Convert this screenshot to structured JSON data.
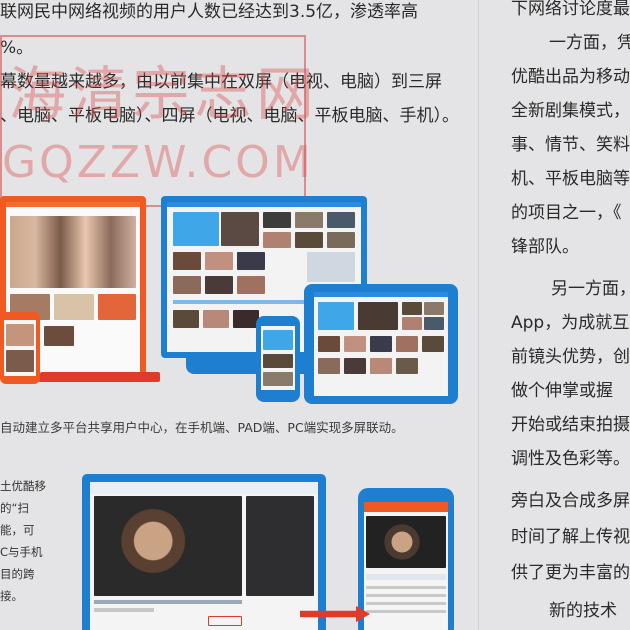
{
  "left_paragraphs": [
    "联网民中网络视频的用户人数已经达到3.5亿，渗透率高",
    "%。",
    "幕数量越来越多，由以前集中在双屏（电视、电脑）到三屏",
    "、电脑、平板电脑）、四屏（电视、电脑、平板电脑、手机）。"
  ],
  "watermark": {
    "cn": "海清宗志网",
    "en": "GQZZW.COM"
  },
  "caption": "自动建立多平台共享用户中心，在手机端、PAD端、PC端实现多屏联动。",
  "small_lines": [
    "土优酷移",
    "的“扫",
    "能，可",
    "C与手机",
    "目的跨",
    "接。"
  ],
  "right_lines": [
    "下网络讨论度最",
    "一方面，凭",
    "优酷出品为移动",
    "全新剧集模式，",
    "事、情节、笑料",
    "机、平板电脑等",
    "的项目之一，《",
    "锋部队。",
    "另一方面，",
    "App，为成就互",
    "前镜头优势，创",
    "做个伸掌或握",
    "开始或结束拍摄",
    "调性及色彩等。",
    "旁白及合成多屏",
    "时间了解上传视",
    "供了更为丰富的",
    "新的技术"
  ],
  "colors": {
    "orange": "#f05a22",
    "blue": "#1e7fd0",
    "red": "#e03a2a"
  }
}
